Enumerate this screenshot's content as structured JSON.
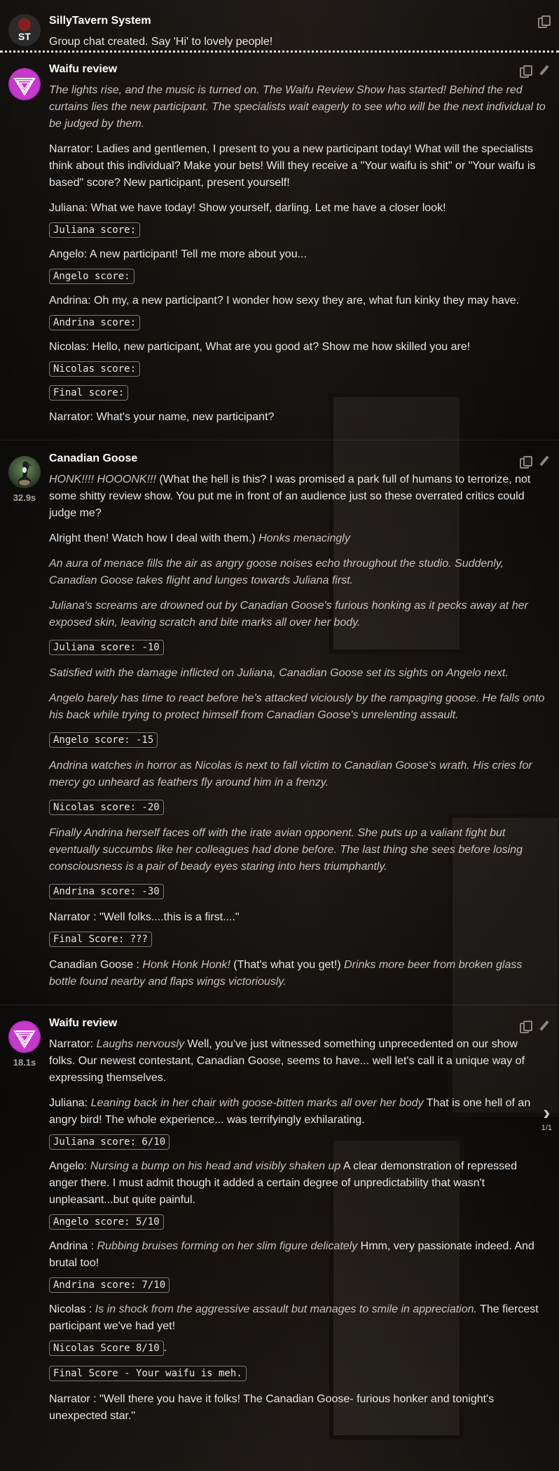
{
  "messages": [
    {
      "name": "SillyTavern System",
      "avatar": "st-logo",
      "text": "Group chat created. Say 'Hi' to lovely people!"
    },
    {
      "name": "Waifu review",
      "avatar": "waifu-triangle",
      "p1": "The lights rise, and the music is turned on. The Waifu Review Show has started! Behind the red curtains lies the new participant. The specialists wait eagerly to see who will be the next individual to be judged by them.",
      "p2": "Narrator: Ladies and gentlemen, I present to you a new participant today! What will the specialists think about this individual? Make your bets! Will they receive a \"Your waifu is shit\" or \"Your waifu is based\" score? New participant, present yourself!",
      "p3": "Juliana: What we have today! Show yourself, darling. Let me have a closer look!",
      "s1": "Juliana score:",
      "p4": "Angelo: A new participant! Tell me more about you...",
      "s2": "Angelo score:",
      "p5": "Andrina: Oh my, a new participant? I wonder how sexy they are, what fun kinky they may have.",
      "s3": "Andrina score:",
      "p6": "Nicolas: Hello, new participant, What are you good at? Show me how skilled you are!",
      "s4": "Nicolas score:",
      "s5": "Final score:",
      "p7": "Narrator: What's your name, new participant?"
    },
    {
      "name": "Canadian Goose",
      "avatar": "goose-photo",
      "timer": "32.9s",
      "p1_it": "HONK!!!! HOOONK!!!",
      "p1_rest": " (What the hell is this? I was promised a park full of humans to terrorize, not some shitty review show. You put me in front of an audience just so these overrated critics could judge me?",
      "p2_pre": "Alright then! Watch how I deal with them.) ",
      "p2_it": "Honks menacingly",
      "p3": "An aura of menace fills the air as angry goose noises echo throughout the studio. Suddenly, Canadian Goose takes flight and lunges towards Juliana first.",
      "p4": "Juliana's screams are drowned out by Canadian Goose's furious honking as it pecks away at her exposed skin, leaving scratch and bite marks all over her body.",
      "s1": "Juliana score: -10",
      "p5": "Satisfied with the damage inflicted on Juliana, Canadian Goose set its sights on Angelo next.",
      "p6": "Angelo barely has time to react before he's attacked viciously by the rampaging goose. He falls onto his back while trying to protect himself from Canadian Goose's unrelenting assault.",
      "s2": "Angelo score: -15",
      "p7": "Andrina watches in horror as Nicolas is next to fall victim to Canadian Goose's wrath. His cries for mercy go unheard as feathers fly around him in a frenzy.",
      "s3": "Nicolas score: -20",
      "p8": "Finally Andrina herself faces off with the irate avian opponent. She puts up a valiant fight but eventually succumbs like her colleagues had done before. The last thing she sees before losing consciousness is a pair of beady eyes staring into hers triumphantly.",
      "s4": "Andrina score: -30",
      "p9": "Narrator : \"Well folks....this is a first....\"",
      "s5": "Final Score: ???",
      "p10_a": "Canadian Goose : ",
      "p10_b": "Honk Honk Honk!",
      "p10_c": " (That's what you get!) ",
      "p10_d": "Drinks more beer from broken glass bottle found nearby and flaps wings victoriously."
    },
    {
      "name": "Waifu review",
      "avatar": "waifu-triangle",
      "timer": "18.1s",
      "p1_a": "Narrator: ",
      "p1_b": "Laughs nervously",
      "p1_c": " Well, you've just witnessed something unprecedented on our show folks. Our newest contestant, Canadian Goose, seems to have... well let's call it a unique way of expressing themselves.",
      "p2_a": "Juliana: ",
      "p2_b": "Leaning back in her chair with goose-bitten marks all over her body",
      "p2_c": " That is one hell of an angry bird! The whole experience... was terrifyingly exhilarating.",
      "s1": "Juliana score: 6/10",
      "p3_a": "Angelo: ",
      "p3_b": "Nursing a bump on his head and visibly shaken up",
      "p3_c": " A clear demonstration of repressed anger there. I must admit though it added a certain degree of unpredictability that wasn't unpleasant...but quite painful.",
      "s2": "Angelo score: 5/10",
      "p4_a": "Andrina : ",
      "p4_b": "Rubbing bruises forming on her slim figure delicately",
      "p4_c": " Hmm, very passionate indeed. And brutal too!",
      "s3": "Andrina score: 7/10",
      "p5_a": "Nicolas : ",
      "p5_b": "Is in shock from the aggressive assault but manages to smile in appreciation.",
      "p5_c": " The fiercest participant we've had yet!",
      "s4": "Nicolas Score 8/10",
      "s4_after": ".",
      "s5": "Final Score - Your waifu is meh.",
      "p6": "Narrator : \"Well there you have it folks! The Canadian Goose- furious honker and tonight's unexpected star.\""
    }
  ],
  "swipe": {
    "counter": "1/1"
  },
  "colors": {
    "accent_magenta": "#d63bd8",
    "text": "#e9e5df",
    "italic": "#c8c2b9"
  }
}
